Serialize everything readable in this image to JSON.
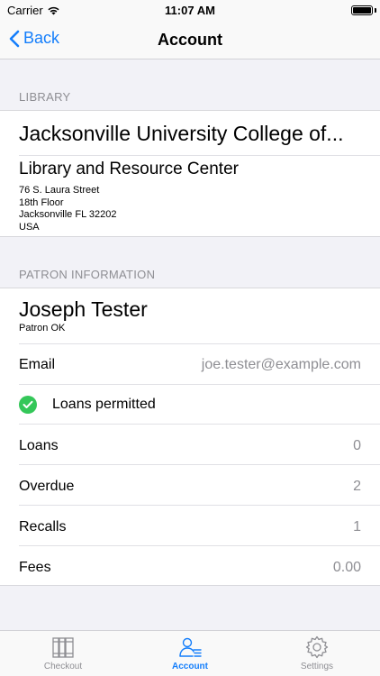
{
  "status_bar": {
    "carrier": "Carrier",
    "time": "11:07 AM"
  },
  "nav": {
    "back_label": "Back",
    "title": "Account"
  },
  "library_section": {
    "header": "LIBRARY",
    "name": "Jacksonville University College of...",
    "subtitle": "Library and Resource Center",
    "address": [
      "76 S. Laura Street",
      "18th Floor",
      "Jacksonville FL 32202",
      "USA"
    ]
  },
  "patron_section": {
    "header": "PATRON INFORMATION",
    "name": "Joseph Tester",
    "status": "Patron OK",
    "email_label": "Email",
    "email_value": "joe.tester@example.com",
    "loans_permitted": "Loans permitted",
    "rows": [
      {
        "label": "Loans",
        "value": "0"
      },
      {
        "label": "Overdue",
        "value": "2"
      },
      {
        "label": "Recalls",
        "value": "1"
      },
      {
        "label": "Fees",
        "value": "0.00"
      }
    ]
  },
  "tabs": [
    {
      "label": "Checkout",
      "icon": "books-icon"
    },
    {
      "label": "Account",
      "icon": "person-list-icon",
      "active": true
    },
    {
      "label": "Settings",
      "icon": "gear-icon"
    }
  ],
  "colors": {
    "accent": "#147efb",
    "success": "#34c759",
    "secondary_text": "#8e8e93"
  }
}
